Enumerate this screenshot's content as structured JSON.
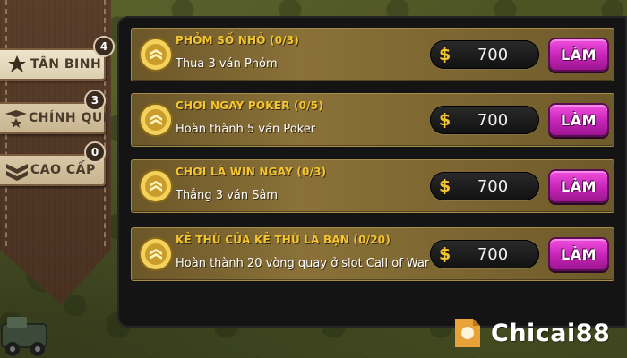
{
  "sidebar": {
    "tabs": [
      {
        "label": "TÂN BINH",
        "badge": "4",
        "icon": "soldier-icon",
        "active": true
      },
      {
        "label": "CHÍNH QUI",
        "badge": "3",
        "icon": "star-rank-icon",
        "active": false
      },
      {
        "label": "CAO CẤP",
        "badge": "0",
        "icon": "chevron-rank-icon",
        "active": false
      }
    ]
  },
  "quests": [
    {
      "title": "PHỎM SỐ NHỎ (0/3)",
      "desc": "Thua 3 ván Phỏm",
      "currency": "$",
      "reward": "700",
      "button": "LÀM"
    },
    {
      "title": "CHƠI NGAY POKER (0/5)",
      "desc": "Hoàn thành 5 ván Poker",
      "currency": "$",
      "reward": "700",
      "button": "LÀM"
    },
    {
      "title": "CHƠI LÀ WIN NGAY (0/3)",
      "desc": "Thắng 3 ván Sâm",
      "currency": "$",
      "reward": "700",
      "button": "LÀM"
    },
    {
      "title": "KẺ THÙ CỦA KẺ THÙ LÀ BẠN (0/20)",
      "desc": "Hoàn thành 20 vòng quay ở slot Call of War",
      "currency": "$",
      "reward": "700",
      "button": "LÀM"
    }
  ],
  "watermark": {
    "text": "Chicai88"
  },
  "colors": {
    "quest_title": "#f4c531",
    "button": "#d02fc2",
    "panel_bg": "#141414",
    "quest_bg": "#8a7138"
  }
}
